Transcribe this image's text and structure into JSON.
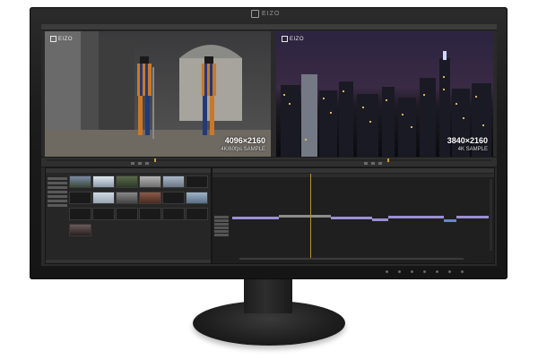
{
  "monitor": {
    "brand": "EIZO"
  },
  "source_monitor": {
    "watermark": "EIZO",
    "resolution": "4096×2160",
    "caption": "4K/60fps SAMPLE"
  },
  "program_monitor": {
    "watermark": "EIZO",
    "resolution": "3840×2160",
    "caption": "4K SAMPLE"
  },
  "colors": {
    "clip_purple": "#9b8fd6",
    "clip_gray": "#8c8c8c",
    "playhead": "#c9a030",
    "ui_panel": "#262626"
  },
  "icons": [
    "eizo-logo-icon",
    "play-icon",
    "step-icon",
    "folder-icon"
  ]
}
